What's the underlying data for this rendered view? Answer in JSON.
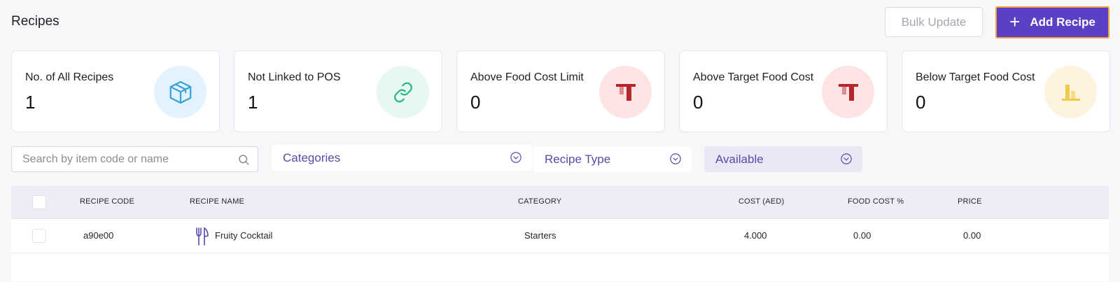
{
  "header": {
    "title": "Recipes",
    "bulk_update_label": "Bulk Update",
    "add_recipe_label": "Add Recipe"
  },
  "stats": [
    {
      "label": "No. of All Recipes",
      "value": "1",
      "icon": "box-icon",
      "color": "#3aa0d8",
      "bg": "#e3f3fd"
    },
    {
      "label": "Not Linked to POS",
      "value": "1",
      "icon": "link-icon",
      "color": "#2fb787",
      "bg": "#e6f8f1"
    },
    {
      "label": "Above Food Cost Limit",
      "value": "0",
      "icon": "bar-up-icon",
      "color": "#b3262b",
      "bg": "#fde3e3"
    },
    {
      "label": "Above Target Food Cost",
      "value": "0",
      "icon": "bar-up-icon",
      "color": "#b3262b",
      "bg": "#fde3e3"
    },
    {
      "label": "Below Target Food Cost",
      "value": "0",
      "icon": "bar-down-icon",
      "color": "#f0c94a",
      "bg": "#fdf3df"
    }
  ],
  "filters": {
    "search_placeholder": "Search by item code or name",
    "categories_label": "Categories",
    "recipe_type_label": "Recipe Type",
    "available_label": "Available"
  },
  "table": {
    "columns": [
      "RECIPE CODE",
      "RECIPE NAME",
      "CATEGORY",
      "COST (AED)",
      "FOOD COST %",
      "PRICE"
    ],
    "rows": [
      {
        "code": "a90e00",
        "name": "Fruity Cocktail",
        "category": "Starters",
        "cost": "4.000",
        "food_cost_pct": "0.00",
        "price": "0.00"
      }
    ]
  }
}
